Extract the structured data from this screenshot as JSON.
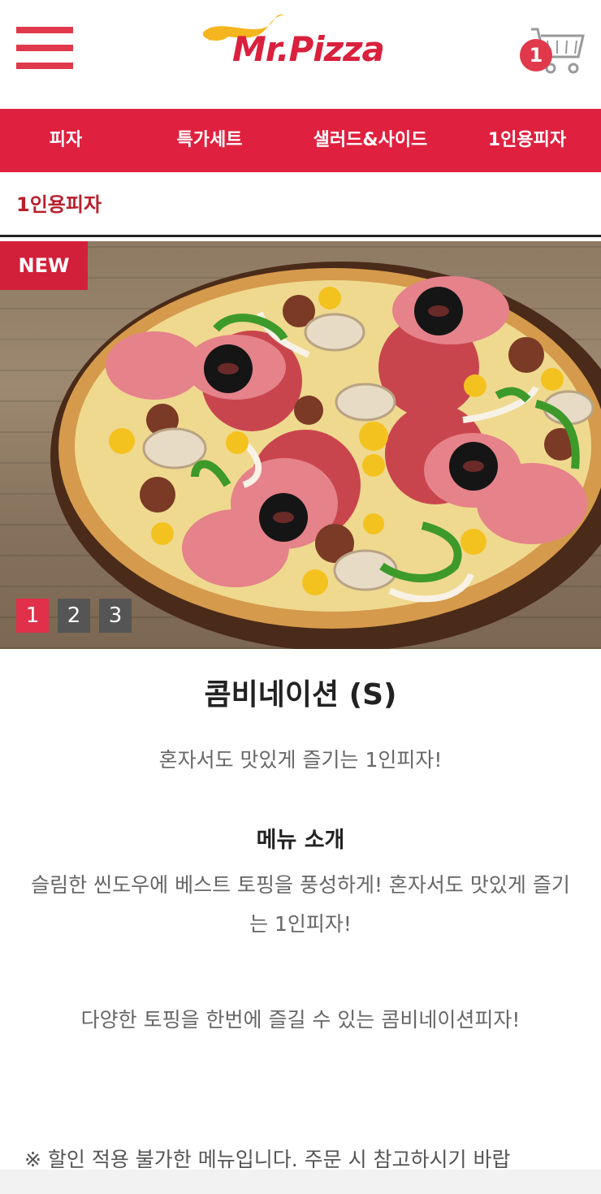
{
  "header": {
    "menu_icon": "hamburger-menu-icon",
    "logo_text": "Mr.Pizza",
    "cart_icon": "shopping-cart-icon",
    "cart_count": "1"
  },
  "nav": {
    "tabs": [
      {
        "label": "피자"
      },
      {
        "label": "특가세트"
      },
      {
        "label": "샐러드&사이드"
      },
      {
        "label": "1인용피자"
      }
    ]
  },
  "breadcrumb": "1인용피자",
  "hero": {
    "badge": "NEW",
    "pages": [
      "1",
      "2",
      "3"
    ],
    "active_page": "1"
  },
  "product": {
    "title": "콤비네이션 (S)",
    "tagline": "혼자서도 맛있게 즐기는 1인피자!",
    "intro_heading": "메뉴 소개",
    "intro_body": "슬림한 씬도우에 베스트 토핑을 풍성하게! 혼자서도 맛있게 즐기는 1인피자!",
    "intro_extra": "다양한 토핑을 한번에 즐길 수 있는 콤비네이션피자!",
    "notice": "※ 할인 적용 불가한 메뉴입니다. 주문 시 참고하시기 바랍"
  },
  "colors": {
    "brand_red": "#e0203f",
    "logo_yellow": "#f5b51e",
    "pager_active": "#e0304a",
    "pager_inactive": "#555555"
  }
}
